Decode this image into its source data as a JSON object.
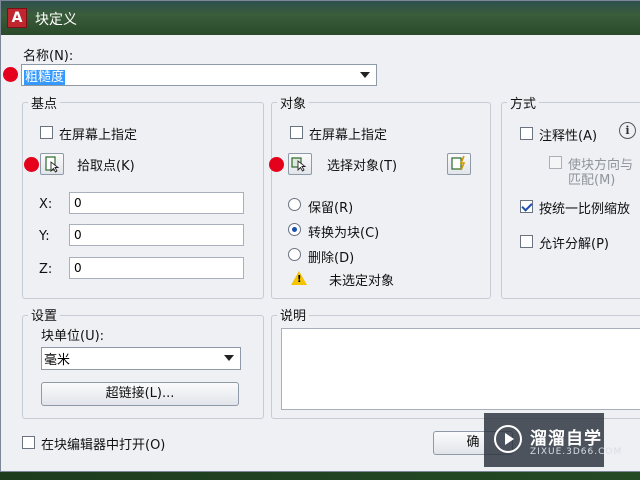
{
  "window": {
    "title": "块定义"
  },
  "name": {
    "label": "名称(N):",
    "value": "粗糙度"
  },
  "base": {
    "title": "基点",
    "specify_on_screen": "在屏幕上指定",
    "pick_point": "拾取点(K)",
    "x_label": "X:",
    "x_value": "0",
    "y_label": "Y:",
    "y_value": "0",
    "z_label": "Z:",
    "z_value": "0"
  },
  "objects": {
    "title": "对象",
    "specify_on_screen": "在屏幕上指定",
    "select_objects": "选择对象(T)",
    "retain": "保留(R)",
    "convert": "转换为块(C)",
    "delete": "删除(D)",
    "warning": "未选定对象",
    "selected": "convert"
  },
  "behavior": {
    "title": "方式",
    "annotative": "注释性(A)",
    "match_orientation": "使块方向与",
    "match_orientation_2": "匹配(M)",
    "scale_uniformly": "按统一比例缩放",
    "allow_explode": "允许分解(P)"
  },
  "settings": {
    "title": "设置",
    "unit_label": "块单位(U):",
    "unit_value": "毫米",
    "hyperlink": "超链接(L)..."
  },
  "description": {
    "title": "说明"
  },
  "footer": {
    "open_in_editor": "在块编辑器中打开(O)",
    "ok_button": "确"
  },
  "watermark": {
    "brand": "溜溜自学",
    "url": "ZIXUE.3D66.COM"
  },
  "colors": {
    "marker": "#e5001b",
    "selection": "#3399ff"
  }
}
